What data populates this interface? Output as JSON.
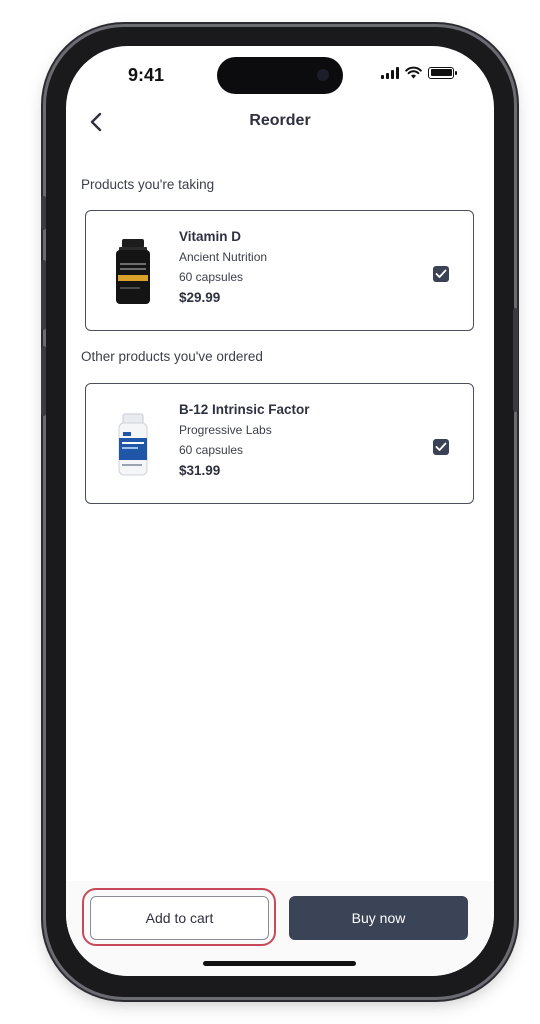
{
  "status_bar": {
    "time": "9:41"
  },
  "nav": {
    "title": "Reorder",
    "back_icon": "chevron-left-icon"
  },
  "sections": {
    "taking_label": "Products you're taking",
    "ordered_label": "Other products you've ordered"
  },
  "products_taking": [
    {
      "name": "Vitamin D",
      "brand": "Ancient Nutrition",
      "quantity": "60 capsules",
      "price": "$29.99",
      "checked": true
    }
  ],
  "products_ordered": [
    {
      "name": "B-12 Intrinsic Factor",
      "brand": "Progressive Labs",
      "quantity": "60 capsules",
      "price": "$31.99",
      "checked": true
    }
  ],
  "actions": {
    "add_to_cart": "Add to cart",
    "buy_now": "Buy now"
  },
  "colors": {
    "primary_button": "#3a4456",
    "checkbox": "#3a4253",
    "highlight": "#c84a5a",
    "text": "#2e3240"
  }
}
